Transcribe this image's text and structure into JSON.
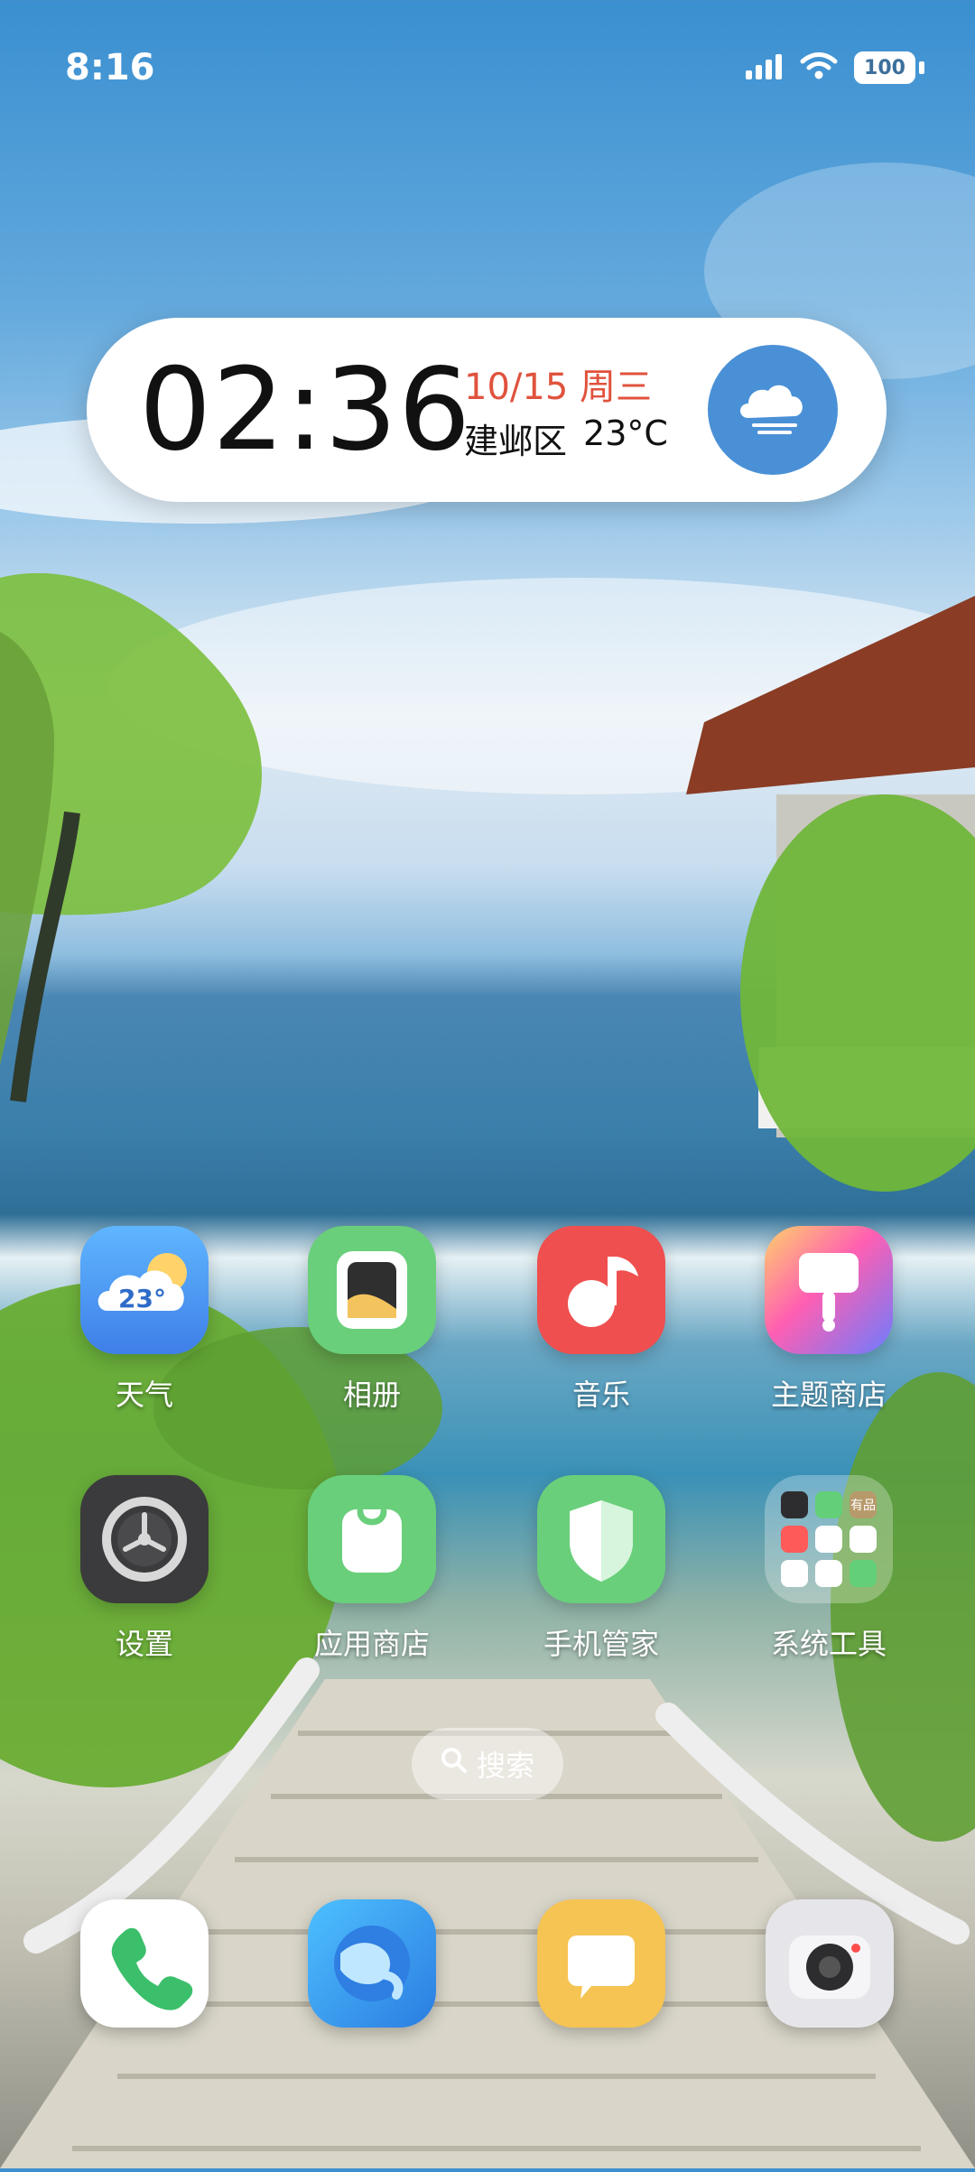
{
  "status_bar": {
    "time": "8:16",
    "battery": "100"
  },
  "widget": {
    "clock": "02:36",
    "date": "10/15 周三",
    "location": "建邺区",
    "temperature": "23°C"
  },
  "apps": [
    {
      "label": "天气",
      "icon": "weather-icon",
      "badge_text": "23°"
    },
    {
      "label": "相册",
      "icon": "gallery-icon"
    },
    {
      "label": "音乐",
      "icon": "music-icon"
    },
    {
      "label": "主题商店",
      "icon": "theme-store-icon"
    },
    {
      "label": "设置",
      "icon": "settings-icon"
    },
    {
      "label": "应用商店",
      "icon": "app-store-icon"
    },
    {
      "label": "手机管家",
      "icon": "phone-manager-icon"
    },
    {
      "label": "系统工具",
      "icon": "folder-icon",
      "folder_tile_text": "有品"
    }
  ],
  "search": {
    "label": "搜索"
  },
  "dock": [
    {
      "icon": "phone-icon"
    },
    {
      "icon": "browser-icon"
    },
    {
      "icon": "messages-icon"
    },
    {
      "icon": "camera-icon"
    }
  ],
  "colors": {
    "date_red": "#e0523d",
    "weather_blue": "#4a90d6",
    "music_red": "#ef4f4f",
    "green": "#69cf7b",
    "settings_dark": "#3b3b3d"
  }
}
